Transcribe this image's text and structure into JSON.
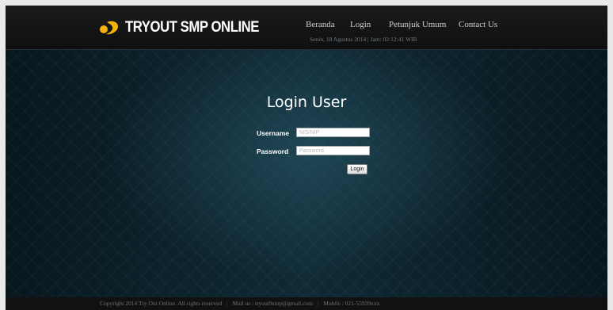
{
  "brand": {
    "logo_text": "TRYOUT SMP ONLINE",
    "logo_icon": "yellow-swoosh-icon",
    "accent_color": "#f5b30a"
  },
  "nav": {
    "items": [
      {
        "label": "Beranda"
      },
      {
        "label": "Login"
      },
      {
        "label": "Petunjuk Umum"
      },
      {
        "label": "Contact Us"
      }
    ],
    "datetime": "Senin, 18 Agustus 2014 | Jam: 02:12:41 WIB"
  },
  "login": {
    "title": "Login User",
    "username_label": "Username",
    "username_placeholder": "NIS/NIP",
    "username_value": "",
    "password_label": "Password",
    "password_placeholder": "Password",
    "password_value": "",
    "button_label": "Login"
  },
  "footer": {
    "copyright": "Copyright 2014 Try Out Online. All rights reserved",
    "mail": "Mail us : tryout9smp@gmail.com",
    "mobile": "Mobile : 021-55939xxx",
    "separator": "|"
  }
}
